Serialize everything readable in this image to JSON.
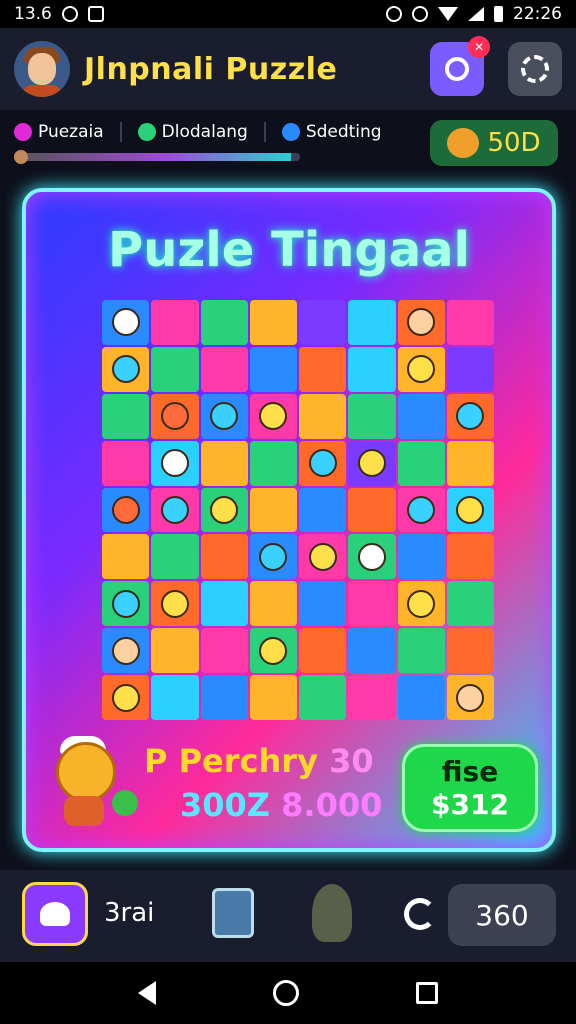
{
  "status_bar": {
    "time_left": "13.6",
    "time_right": "22:26"
  },
  "header": {
    "title": "Jlnpnali Puzzle"
  },
  "categories": [
    {
      "label": "Puezaia",
      "color": "#e02ad8"
    },
    {
      "label": "Dlodalang",
      "color": "#2ad07a"
    },
    {
      "label": "Sdedting",
      "color": "#2a8aff"
    }
  ],
  "progress": {
    "fraction": 0.97
  },
  "coins": {
    "value": "50D"
  },
  "board": {
    "title": "Puzle Tingaal"
  },
  "reward": {
    "title": "P Perchry",
    "title_num": "30",
    "line_a": "300Z",
    "line_b": "8.000"
  },
  "price_button": {
    "label": "fise",
    "value": "$312"
  },
  "bottom_bar": {
    "label": "3rai",
    "count": "360"
  },
  "grid_colors": [
    "#2a8aff",
    "#ff3aa8",
    "#2ad07a",
    "#ffb42a",
    "#7a3aff",
    "#2ad0ff",
    "#ff6a2a",
    "#ff3aa8",
    "#ffb42a",
    "#2ad07a",
    "#ff3aa8",
    "#2a8aff",
    "#ff6a2a",
    "#2ad0ff",
    "#ffb42a",
    "#7a3aff",
    "#2ad07a",
    "#ff6a2a",
    "#2a8aff",
    "#ff3aa8",
    "#ffb42a",
    "#2ad07a",
    "#2a8aff",
    "#ff6a2a",
    "#ff3aa8",
    "#2ad0ff",
    "#ffb42a",
    "#2ad07a",
    "#ff6a2a",
    "#7a3aff",
    "#2ad07a",
    "#ffb42a",
    "#2a8aff",
    "#ff3aa8",
    "#2ad07a",
    "#ffb42a",
    "#2a8aff",
    "#ff6a2a",
    "#ff3aa8",
    "#2ad0ff",
    "#ffb42a",
    "#2ad07a",
    "#ff6a2a",
    "#2a8aff",
    "#ff3aa8",
    "#2ad07a",
    "#2a8aff",
    "#ff6a2a",
    "#2ad07a",
    "#ff6a2a",
    "#2ad0ff",
    "#ffb42a",
    "#2a8aff",
    "#ff3aa8",
    "#ffb42a",
    "#2ad07a",
    "#2a8aff",
    "#ffb42a",
    "#ff3aa8",
    "#2ad07a",
    "#ff6a2a",
    "#2a8aff",
    "#2ad07a",
    "#ff6a2a",
    "#ff6a2a",
    "#2ad0ff",
    "#2a8aff",
    "#ffb42a",
    "#2ad07a",
    "#ff3aa8",
    "#2a8aff",
    "#ffb42a"
  ],
  "grid_characters": [
    1,
    0,
    0,
    0,
    0,
    0,
    1,
    0,
    1,
    0,
    0,
    0,
    0,
    0,
    1,
    0,
    0,
    1,
    1,
    1,
    0,
    0,
    0,
    1,
    0,
    1,
    0,
    0,
    1,
    1,
    0,
    0,
    1,
    1,
    1,
    0,
    0,
    0,
    1,
    1,
    0,
    0,
    0,
    1,
    1,
    1,
    0,
    0,
    1,
    1,
    0,
    0,
    0,
    0,
    1,
    0,
    1,
    0,
    0,
    1,
    0,
    0,
    0,
    0,
    1,
    0,
    0,
    0,
    0,
    0,
    0,
    1
  ]
}
